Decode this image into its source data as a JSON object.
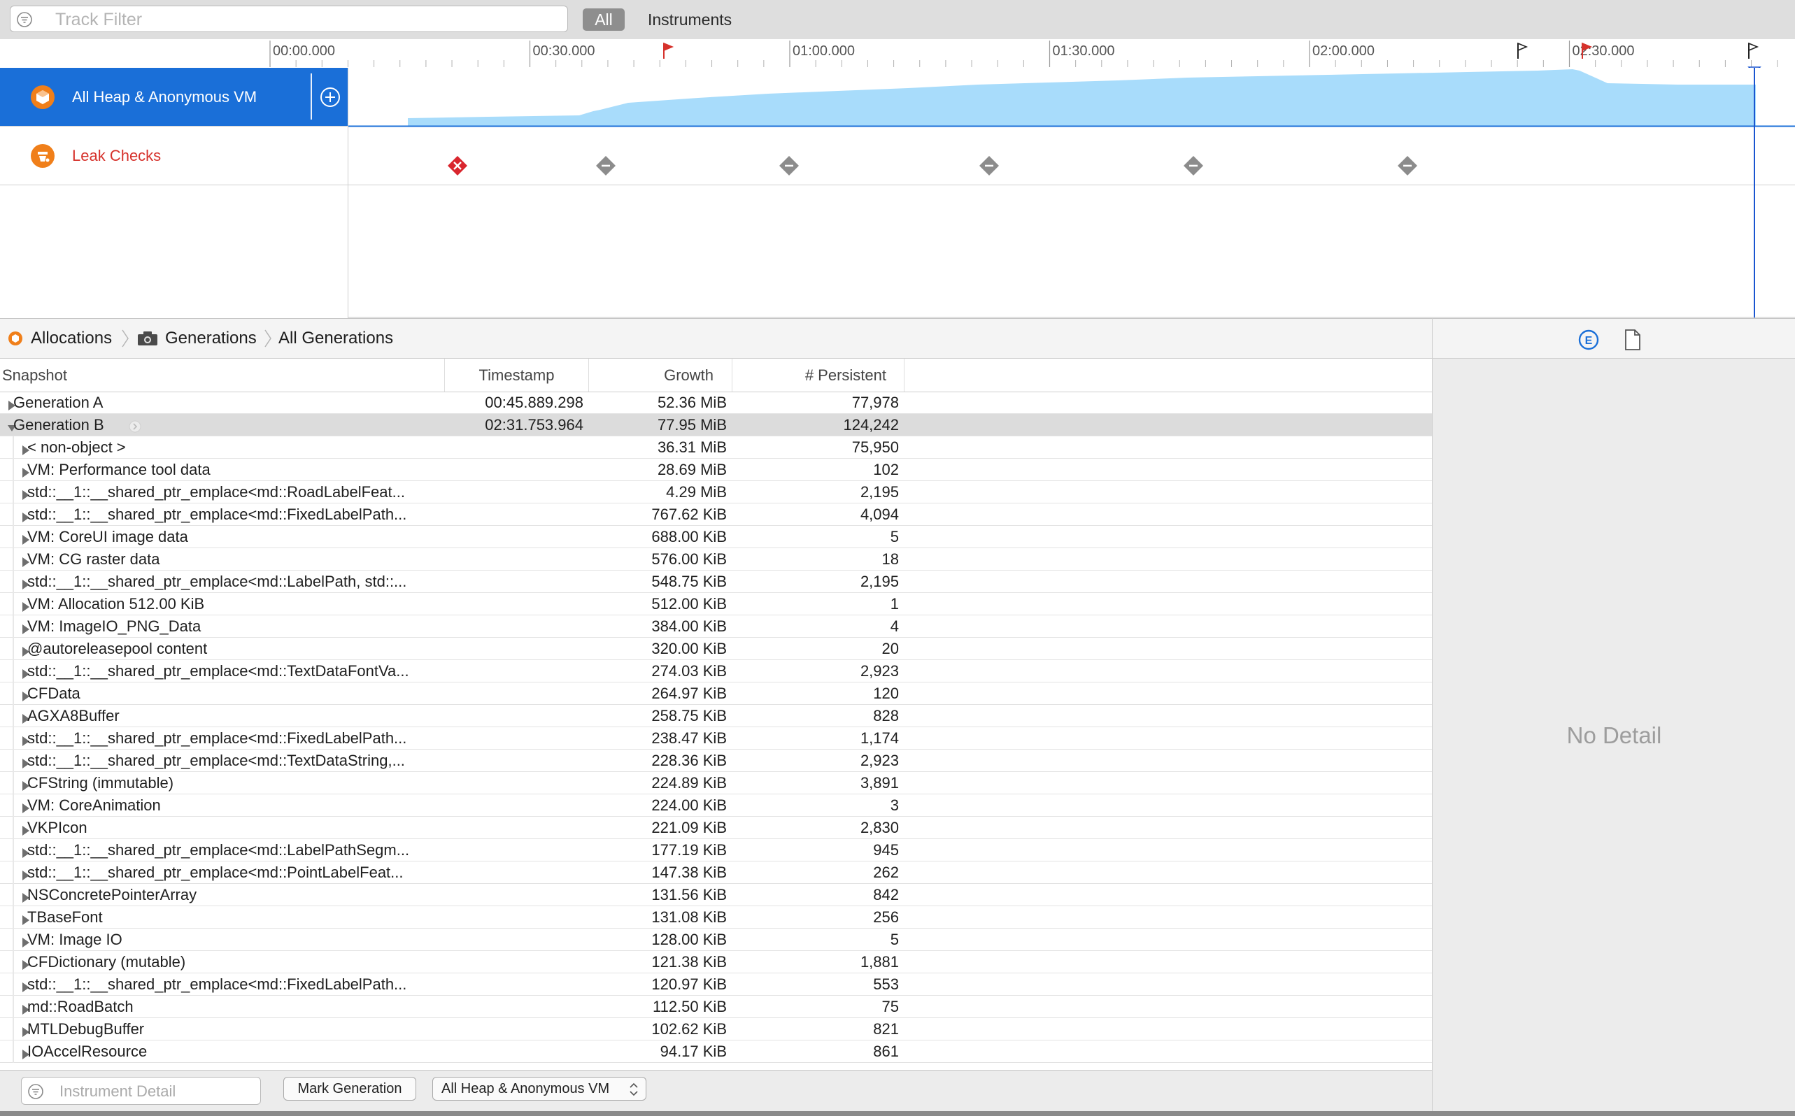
{
  "filter": {
    "placeholder": "Track Filter",
    "all_label": "All",
    "instruments_label": "Instruments"
  },
  "ruler": {
    "ticks": [
      "00:00.000",
      "00:30.000",
      "01:00.000",
      "01:30.000",
      "02:00.000",
      "02:30.000"
    ]
  },
  "tracks": [
    {
      "label": "All Heap & Anonymous VM",
      "selected": true
    },
    {
      "label": "Leak Checks",
      "selected": false
    }
  ],
  "breadcrumb": [
    "Allocations",
    "Generations",
    "All Generations"
  ],
  "table": {
    "columns": {
      "snapshot": "Snapshot",
      "timestamp": "Timestamp",
      "growth": "Growth",
      "persistent": "# Persistent"
    },
    "rows": [
      {
        "name": "Generation A",
        "timestamp": "00:45.889.298",
        "growth": "52.36 MiB",
        "persistent": "77,978",
        "level": 0,
        "expanded": false
      },
      {
        "name": "Generation B",
        "timestamp": "02:31.753.964",
        "growth": "77.95 MiB",
        "persistent": "124,242",
        "level": 0,
        "expanded": true,
        "selected": true
      },
      {
        "name": "< non-object >",
        "timestamp": "",
        "growth": "36.31 MiB",
        "persistent": "75,950",
        "level": 1
      },
      {
        "name": "VM: Performance tool data",
        "timestamp": "",
        "growth": "28.69 MiB",
        "persistent": "102",
        "level": 1
      },
      {
        "name": "std::__1::__shared_ptr_emplace<md::RoadLabelFeat...",
        "timestamp": "",
        "growth": "4.29 MiB",
        "persistent": "2,195",
        "level": 1
      },
      {
        "name": "std::__1::__shared_ptr_emplace<md::FixedLabelPath...",
        "timestamp": "",
        "growth": "767.62 KiB",
        "persistent": "4,094",
        "level": 1
      },
      {
        "name": "VM: CoreUI image data",
        "timestamp": "",
        "growth": "688.00 KiB",
        "persistent": "5",
        "level": 1
      },
      {
        "name": "VM: CG raster data",
        "timestamp": "",
        "growth": "576.00 KiB",
        "persistent": "18",
        "level": 1
      },
      {
        "name": "std::__1::__shared_ptr_emplace<md::LabelPath, std::...",
        "timestamp": "",
        "growth": "548.75 KiB",
        "persistent": "2,195",
        "level": 1
      },
      {
        "name": "VM: Allocation 512.00 KiB",
        "timestamp": "",
        "growth": "512.00 KiB",
        "persistent": "1",
        "level": 1
      },
      {
        "name": "VM: ImageIO_PNG_Data",
        "timestamp": "",
        "growth": "384.00 KiB",
        "persistent": "4",
        "level": 1
      },
      {
        "name": "@autoreleasepool content",
        "timestamp": "",
        "growth": "320.00 KiB",
        "persistent": "20",
        "level": 1
      },
      {
        "name": "std::__1::__shared_ptr_emplace<md::TextDataFontVa...",
        "timestamp": "",
        "growth": "274.03 KiB",
        "persistent": "2,923",
        "level": 1
      },
      {
        "name": "CFData",
        "timestamp": "",
        "growth": "264.97 KiB",
        "persistent": "120",
        "level": 1
      },
      {
        "name": "AGXA8Buffer",
        "timestamp": "",
        "growth": "258.75 KiB",
        "persistent": "828",
        "level": 1
      },
      {
        "name": "std::__1::__shared_ptr_emplace<md::FixedLabelPath...",
        "timestamp": "",
        "growth": "238.47 KiB",
        "persistent": "1,174",
        "level": 1
      },
      {
        "name": "std::__1::__shared_ptr_emplace<md::TextDataString,...",
        "timestamp": "",
        "growth": "228.36 KiB",
        "persistent": "2,923",
        "level": 1
      },
      {
        "name": "CFString (immutable)",
        "timestamp": "",
        "growth": "224.89 KiB",
        "persistent": "3,891",
        "level": 1
      },
      {
        "name": "VM: CoreAnimation",
        "timestamp": "",
        "growth": "224.00 KiB",
        "persistent": "3",
        "level": 1
      },
      {
        "name": "VKPIcon",
        "timestamp": "",
        "growth": "221.09 KiB",
        "persistent": "2,830",
        "level": 1
      },
      {
        "name": "std::__1::__shared_ptr_emplace<md::LabelPathSegm...",
        "timestamp": "",
        "growth": "177.19 KiB",
        "persistent": "945",
        "level": 1
      },
      {
        "name": "std::__1::__shared_ptr_emplace<md::PointLabelFeat...",
        "timestamp": "",
        "growth": "147.38 KiB",
        "persistent": "262",
        "level": 1
      },
      {
        "name": "NSConcretePointerArray",
        "timestamp": "",
        "growth": "131.56 KiB",
        "persistent": "842",
        "level": 1
      },
      {
        "name": "TBaseFont",
        "timestamp": "",
        "growth": "131.08 KiB",
        "persistent": "256",
        "level": 1
      },
      {
        "name": "VM: Image IO",
        "timestamp": "",
        "growth": "128.00 KiB",
        "persistent": "5",
        "level": 1
      },
      {
        "name": "CFDictionary (mutable)",
        "timestamp": "",
        "growth": "121.38 KiB",
        "persistent": "1,881",
        "level": 1
      },
      {
        "name": "std::__1::__shared_ptr_emplace<md::FixedLabelPath...",
        "timestamp": "",
        "growth": "120.97 KiB",
        "persistent": "553",
        "level": 1
      },
      {
        "name": "md::RoadBatch",
        "timestamp": "",
        "growth": "112.50 KiB",
        "persistent": "75",
        "level": 1
      },
      {
        "name": "MTLDebugBuffer",
        "timestamp": "",
        "growth": "102.62 KiB",
        "persistent": "821",
        "level": 1
      },
      {
        "name": "IOAccelResource",
        "timestamp": "",
        "growth": "94.17 KiB",
        "persistent": "861",
        "level": 1
      }
    ]
  },
  "inspector": {
    "empty_text": "No Detail"
  },
  "bottom": {
    "detail_placeholder": "Instrument Detail",
    "mark_generation_label": "Mark Generation",
    "heap_select_value": "All Heap & Anonymous VM"
  },
  "icons": {
    "track_filter": "filter-icon",
    "add_track": "plus-circle-icon",
    "allocations": "allocations-icon",
    "generations": "camera-icon",
    "inspector_extended": "extended-detail-icon",
    "inspector_document": "document-icon",
    "leak_fail": "leak-failed-icon",
    "leak_pass": "leak-ok-icon",
    "flag": "flag-icon"
  },
  "colors": {
    "accent": "#1a6fd8",
    "heap_fill": "#a8dcfb",
    "leak_label": "#d6322c",
    "leak_fail": "#d9262e",
    "leak_ok": "#8c8c8c",
    "track_icon": "#f07f1a"
  }
}
